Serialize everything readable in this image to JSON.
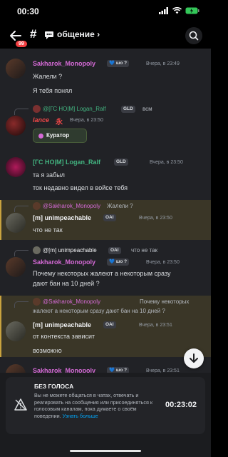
{
  "status": {
    "time": "00:30"
  },
  "header": {
    "badge": "99",
    "hash": "#",
    "channel": "общение ›"
  },
  "messages": [
    {
      "author": "Sakharok_Monopoly",
      "tag": "💙 шо ?",
      "time": "Вчера, в 23:49",
      "lines": [
        "Жалели ?",
        "Я тебя понял"
      ]
    },
    {
      "reply_author": "@[ГС НО|М] Logan_Ralf",
      "reply_tag": "GLD",
      "reply_text": "всм",
      "author": "lance",
      "author_glyph": "永",
      "time": "Вчера, в 23:50",
      "role_pill": "Куратор"
    },
    {
      "author": "[ГС НО|М] Logan_Ralf",
      "tag": "GLD",
      "time": "Вчера, в 23:50",
      "lines": [
        "та я забыл",
        "ток недавно видел в войсе тебя"
      ]
    },
    {
      "reply_author": "@Sakharok_Monopoly",
      "reply_text": "Жалели ?",
      "author": "[m] unimpeachable",
      "tag": "OAI",
      "time": "Вчера, в 23:50",
      "lines": [
        "что не так"
      ]
    },
    {
      "reply_author": "@[m] unimpeachable",
      "reply_tag": "OAI",
      "reply_text": "что не так",
      "author": "Sakharok_Monopoly",
      "tag": "💙 шо ?",
      "time": "Вчера, в 23:50",
      "lines": [
        "Почему некоторых жалеют а некоторым сразу",
        "дают бан на 10 дней ?"
      ]
    },
    {
      "reply_author": "@Sakharok_Monopoly",
      "reply_text": "Почему некоторых",
      "reply_text2": "жалеют а некоторым сразу дают бан на 10 дней ?",
      "author": "[m] unimpeachable",
      "tag": "OAI",
      "time": "Вчера, в 23:51",
      "lines": [
        "от контекста зависит",
        "возможно"
      ]
    },
    {
      "author": "Sakharok_Monopoly",
      "tag": "💙 шо ?",
      "time": "Вчера, в 23:51"
    }
  ],
  "notice": {
    "title": "БЕЗ ГОЛОСА",
    "text": "Вы не можете общаться в чатах, отвечать и реагировать на сообщения или присоединяться к голосовым каналам, пока думаете о своём поведении.",
    "link": "Узнать больше",
    "timer": "00:23:02"
  },
  "colors": {
    "pink": "#d56ad6",
    "green": "#43b581",
    "lance_red": "#f04747",
    "accent": "#5865f2",
    "mention_bg": "#3a3627"
  },
  "icons": [
    "back-arrow-icon",
    "hash-icon",
    "chat-bubble-icon",
    "search-icon",
    "mute-icon",
    "arrow-down-icon"
  ]
}
